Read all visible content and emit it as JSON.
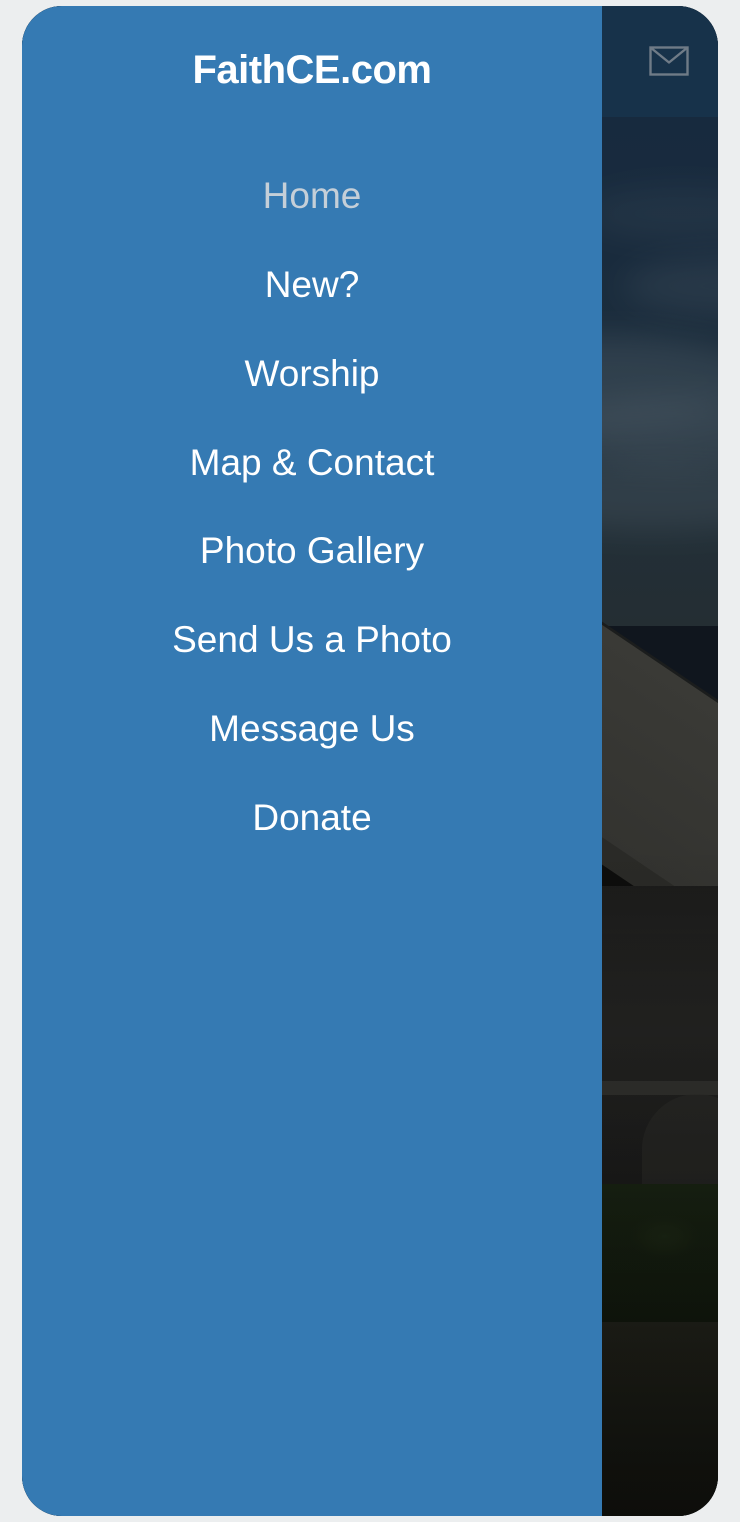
{
  "app": {
    "brand": "FaithCE.com",
    "colors": {
      "drawer_blue": "#357AB3",
      "appbar_navy": "#17324A",
      "page_background": "#ECEEEF",
      "nav_text": "#FFFFFF",
      "nav_text_dim": "#C5CFD8",
      "mail_icon_stroke": "#6F7B87"
    }
  },
  "appbar": {
    "mail_icon": "envelope-icon",
    "mail_label": "Message Us"
  },
  "drawer": {
    "title": "FaithCE.com",
    "items": [
      {
        "label": "Home",
        "state": "active-dim"
      },
      {
        "label": "New?",
        "state": "normal"
      },
      {
        "label": "Worship",
        "state": "normal"
      },
      {
        "label": "Map & Contact",
        "state": "normal"
      },
      {
        "label": "Photo Gallery",
        "state": "normal"
      },
      {
        "label": "Send Us a Photo",
        "state": "normal"
      },
      {
        "label": "Message Us",
        "state": "normal"
      },
      {
        "label": "Donate",
        "state": "normal"
      }
    ]
  },
  "background": {
    "description": "Dark photograph of a stone church at dusk with cloudy sky, hedge and lawn"
  }
}
